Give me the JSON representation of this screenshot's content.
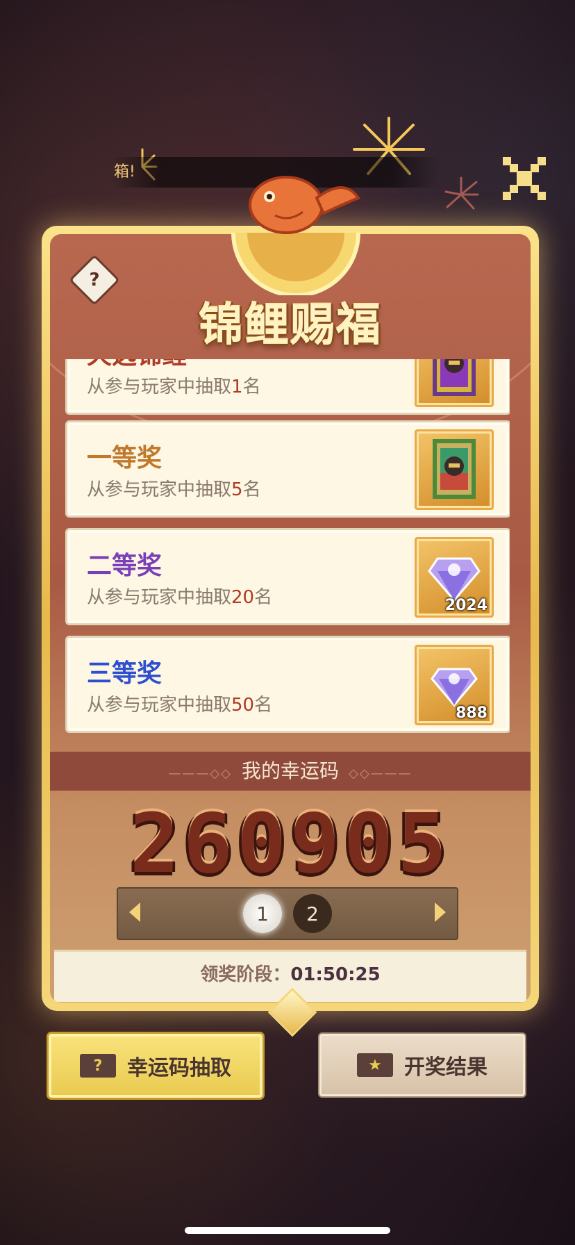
{
  "ticker": {
    "text": "箱!"
  },
  "panel": {
    "title": "锦鲤赐福",
    "help_label": "?"
  },
  "prizes": [
    {
      "name": "天选锦鲤",
      "desc_prefix": "从参与玩家中抽取",
      "count": "1",
      "desc_suffix": "名",
      "name_color": "#b03a24",
      "reward_icon": "card-icon-gold",
      "reward_count": ""
    },
    {
      "name": "一等奖",
      "desc_prefix": "从参与玩家中抽取",
      "count": "5",
      "desc_suffix": "名",
      "name_color": "#c0782a",
      "reward_icon": "card-icon-green",
      "reward_count": ""
    },
    {
      "name": "二等奖",
      "desc_prefix": "从参与玩家中抽取",
      "count": "20",
      "desc_suffix": "名",
      "name_color": "#7a3fb8",
      "reward_icon": "diamond-icon",
      "reward_count": "2024"
    },
    {
      "name": "三等奖",
      "desc_prefix": "从参与玩家中抽取",
      "count": "50",
      "desc_suffix": "名",
      "name_color": "#2d4fd0",
      "reward_icon": "diamond-icon",
      "reward_count": "888"
    }
  ],
  "lucky": {
    "label": "我的幸运码",
    "code": "260905",
    "pages": [
      "1",
      "2"
    ],
    "active_page": "1"
  },
  "stage": {
    "label": "领奖阶段：",
    "time": "01:50:25"
  },
  "buttons": {
    "draw": "幸运码抽取",
    "result": "开奖结果"
  }
}
